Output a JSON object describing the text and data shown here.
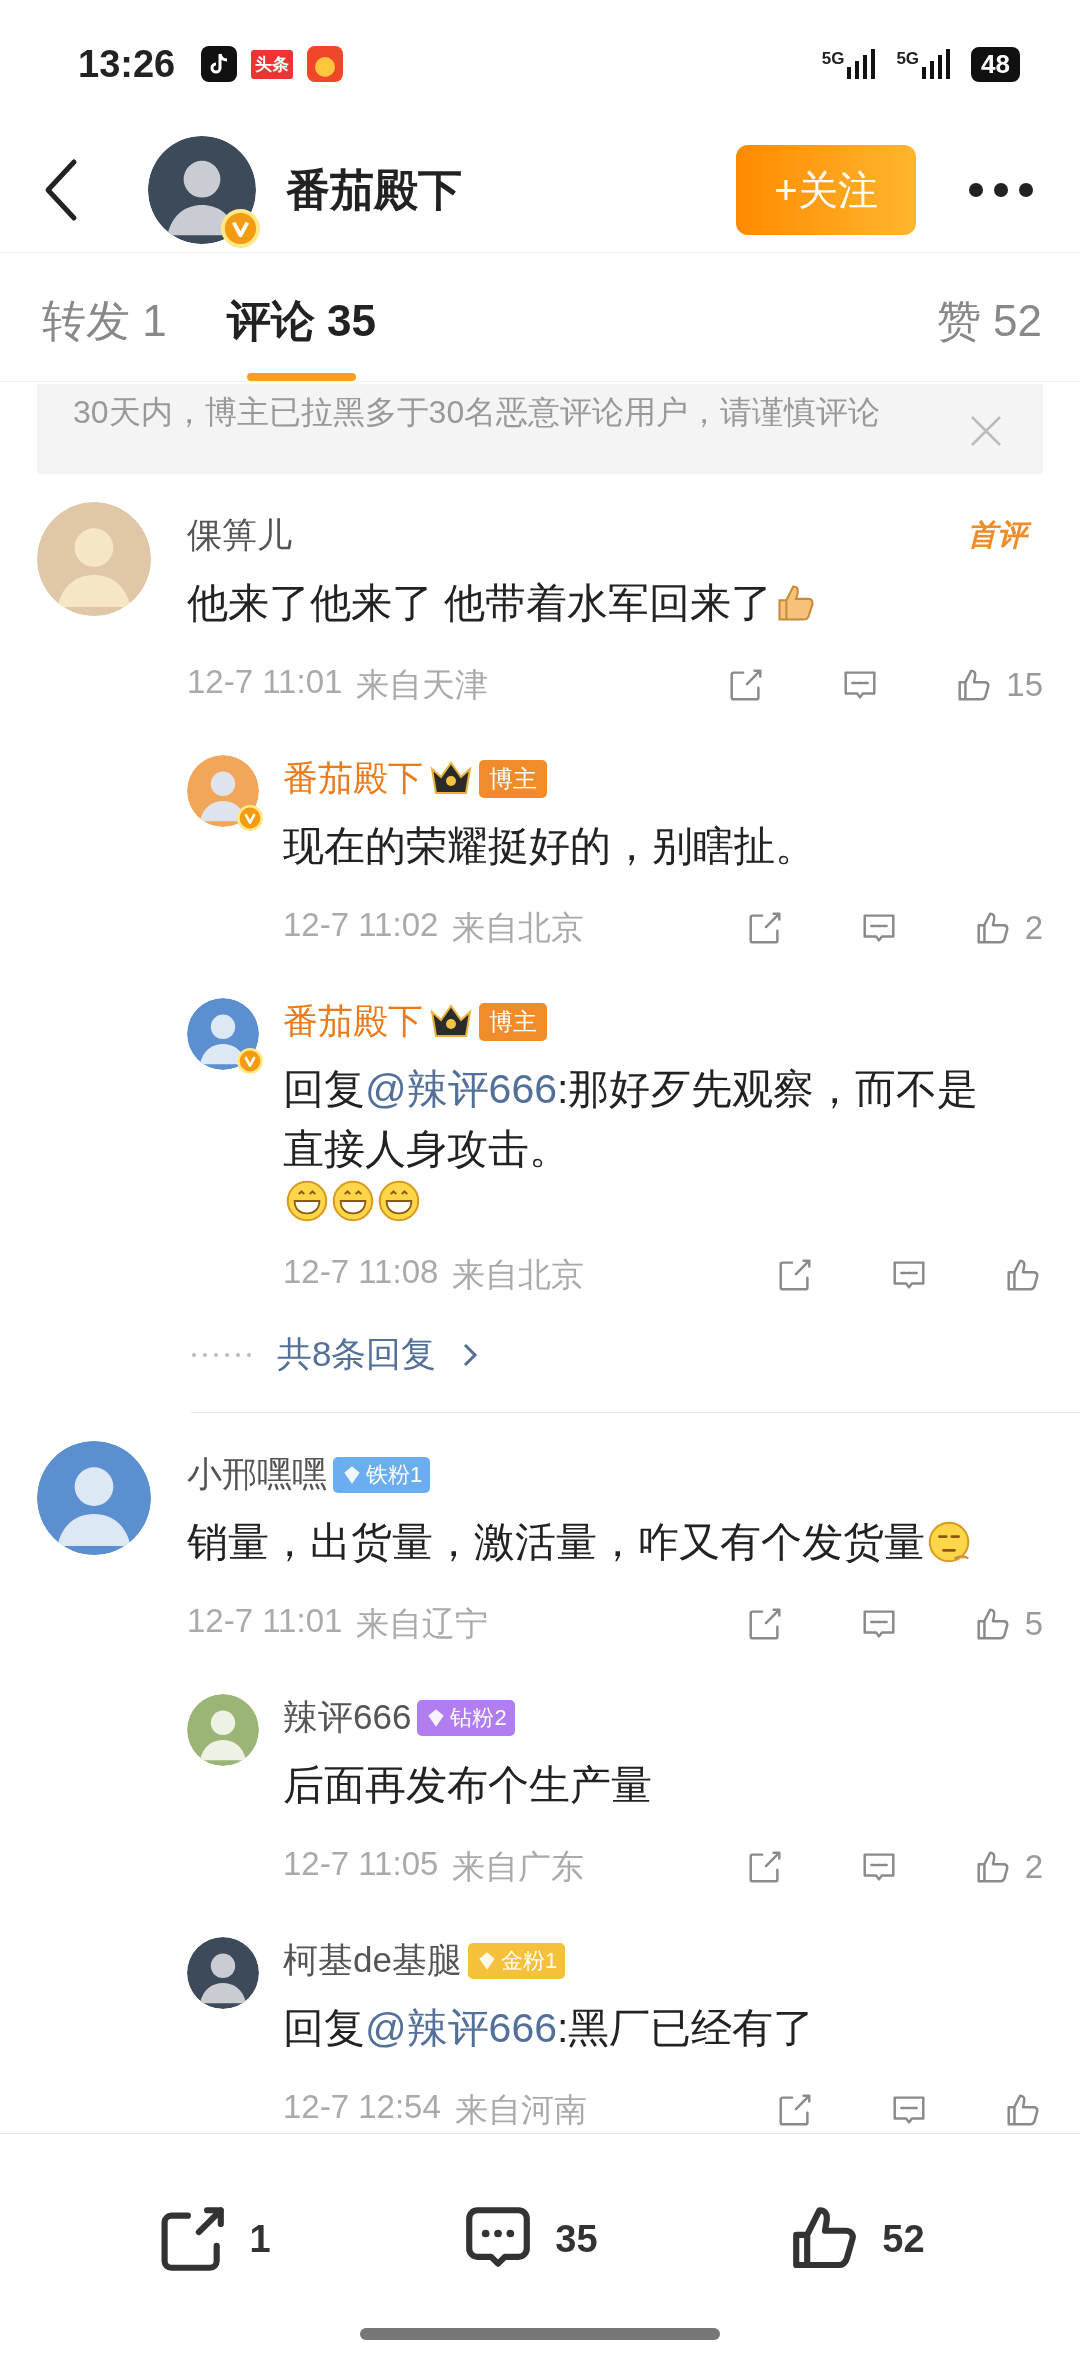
{
  "status_bar": {
    "time": "13:26",
    "apps": [
      {
        "kind": "tiktok"
      },
      {
        "kind": "news",
        "label": "头条"
      },
      {
        "kind": "shop"
      }
    ],
    "networks": [
      "5G",
      "5G"
    ],
    "battery": "48"
  },
  "header": {
    "name": "番茄殿下",
    "verified": true,
    "follow": "+关注"
  },
  "tabs": [
    {
      "label": "转发 1",
      "selected": false
    },
    {
      "label": "评论 35",
      "selected": true
    }
  ],
  "likes_tab": "赞 52",
  "notice": {
    "text": "30天内，博主已拉黑多于30名恶意评论用户，请谨慎评论"
  },
  "comments": [
    {
      "user": "倮箅儿",
      "verified": false,
      "tag": "首评",
      "text": {
        "prefix": "他来了他来了  他带着水军回来了"
      },
      "emoji": [
        {
          "kind": "thumb"
        }
      ],
      "time": "12-7 11:01",
      "location": "来自天津",
      "likes": "15",
      "more": "共8条回复",
      "replies": [
        {
          "user": "番茄殿下",
          "verified": true,
          "badge": {
            "kind": "owner",
            "text": "博主"
          },
          "text": {
            "prefix": "现在的荣耀挺好的，别瞎扯。"
          },
          "time": "12-7 11:02",
          "location": "来自北京",
          "likes": "2"
        },
        {
          "user": "番茄殿下",
          "verified": true,
          "badge": {
            "kind": "owner",
            "text": "博主"
          },
          "text": {
            "prefix": "回复",
            "mention": "@辣评666",
            "body": ":那好歹先观察，而不是直接人身攻击。"
          },
          "emoji": [
            {
              "kind": "grin"
            },
            {
              "kind": "grin"
            },
            {
              "kind": "grin"
            }
          ],
          "time": "12-7 11:08",
          "location": "来自北京"
        }
      ]
    },
    {
      "user": "小邢嘿嘿",
      "verified": false,
      "badge": {
        "kind": "iron",
        "text": "铁粉1"
      },
      "text": {
        "prefix": "销量，出货量，激活量，咋又有个发货量"
      },
      "emoji": [
        {
          "kind": "think"
        }
      ],
      "time": "12-7 11:01",
      "location": "来自辽宁",
      "likes": "5",
      "replies": [
        {
          "user": "辣评666",
          "verified": false,
          "badge": {
            "kind": "diamond",
            "text": "钻粉2"
          },
          "text": {
            "prefix": "后面再发布个生产量"
          },
          "time": "12-7 11:05",
          "location": "来自广东",
          "likes": "2"
        },
        {
          "user": "柯基de基腿",
          "verified": false,
          "badge": {
            "kind": "gold",
            "text": "金粉1"
          },
          "text": {
            "prefix": "回复",
            "mention": "@辣评666",
            "body": ":黑厂已经有了"
          },
          "time": "12-7 12:54",
          "location": "来自河南"
        }
      ]
    }
  ],
  "bottom_bar": {
    "reposts": "1",
    "comments": "35",
    "likes": "52"
  }
}
